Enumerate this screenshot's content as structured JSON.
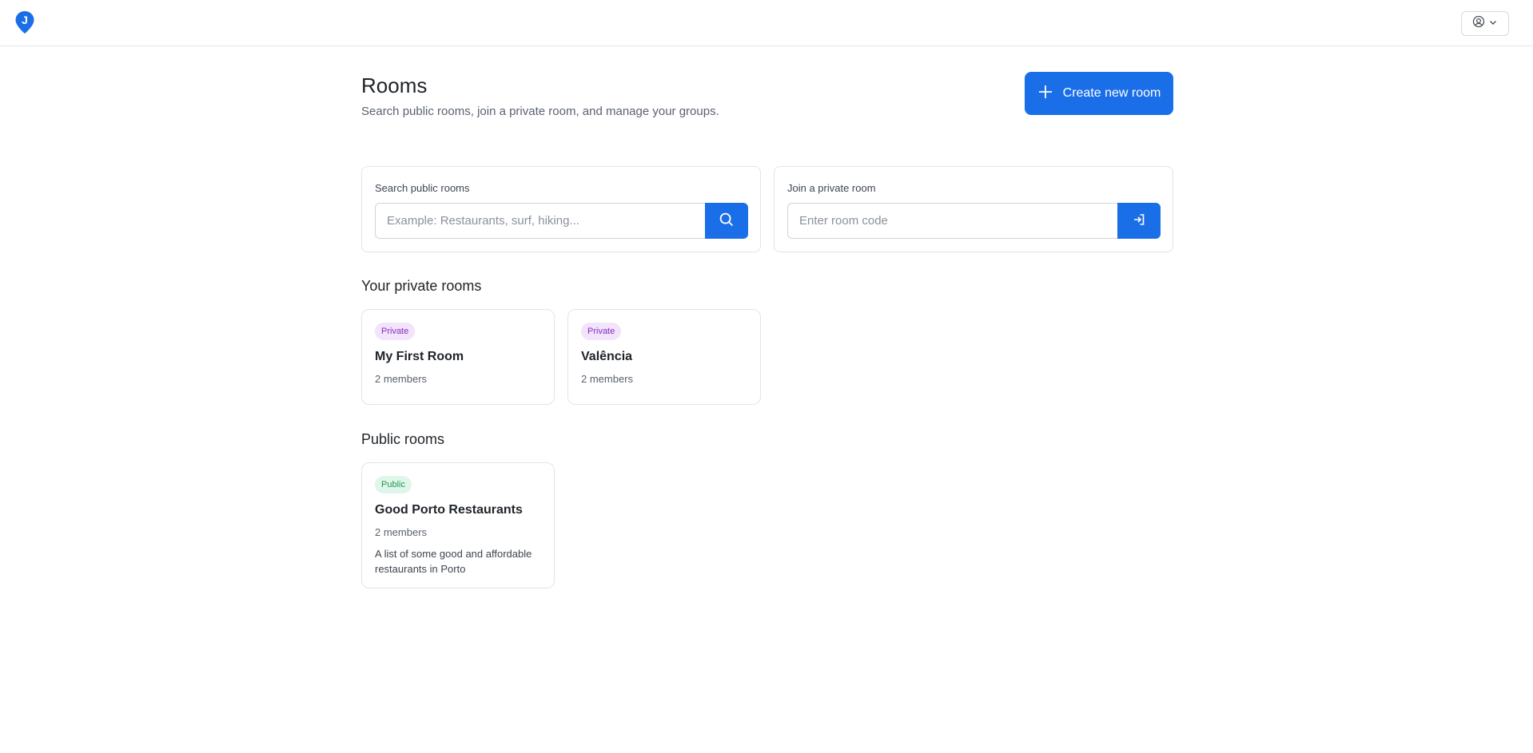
{
  "header": {
    "logo_letter": "J",
    "brand_color": "#1a6fe8",
    "user_menu_icon": "user-circle-icon",
    "user_menu_chevron": "chevron-down-icon"
  },
  "page": {
    "title": "Rooms",
    "subtitle": "Search public rooms, join a private room, and manage your groups.",
    "create_button_label": "Create new room"
  },
  "search": {
    "label": "Search public rooms",
    "placeholder": "Example: Restaurants, surf, hiking...",
    "button_icon": "search-icon"
  },
  "join": {
    "label": "Join a private room",
    "placeholder": "Enter room code",
    "button_icon": "login-arrow-icon"
  },
  "private_rooms": {
    "title": "Your private rooms",
    "items": [
      {
        "badge": "Private",
        "name": "My First Room",
        "members": "2 members"
      },
      {
        "badge": "Private",
        "name": "Valência",
        "members": "2 members"
      }
    ]
  },
  "public_rooms": {
    "title": "Public rooms",
    "items": [
      {
        "badge": "Public",
        "name": "Good Porto Restaurants",
        "members": "2 members",
        "description": "A list of some good and affordable restaurants in Porto"
      }
    ]
  }
}
